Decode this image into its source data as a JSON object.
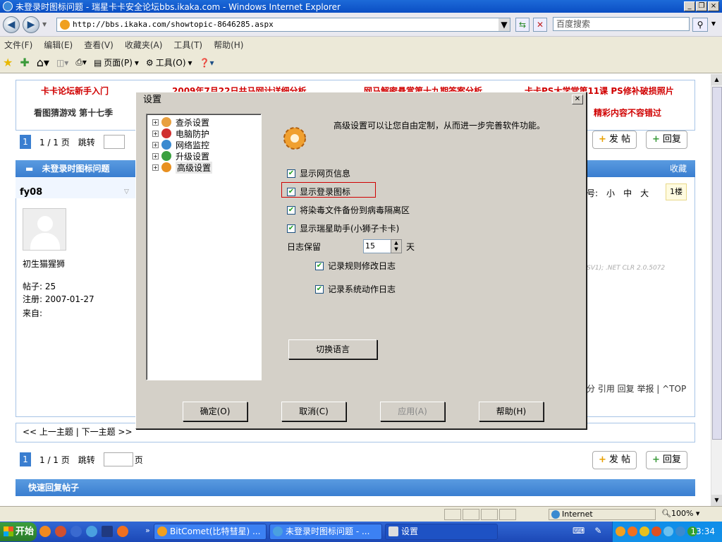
{
  "window": {
    "title": "未登录时图标问题 - 瑞星卡卡安全论坛bbs.ikaka.com - Windows Internet Explorer"
  },
  "browser": {
    "address": "http://bbs.ikaka.com/showtopic-8646285.aspx",
    "search_placeholder": "百度搜索",
    "menu": [
      "文件(F)",
      "编辑(E)",
      "查看(V)",
      "收藏夹(A)",
      "工具(T)",
      "帮助(H)"
    ],
    "toolbar": {
      "page_label": "页面(P)",
      "tools_label": "工具(O)"
    },
    "zone": "Internet",
    "zoom": "100%"
  },
  "forum": {
    "links_row1": [
      "卡卡论坛新手入门",
      "2009年7月22日共马网计详细分析",
      "网马解密悬赏第十九期答案分析",
      "卡卡PS大学堂第11课 PS修补破损照片"
    ],
    "links_row2": [
      "看图猜游戏 第十七季",
      "精彩内容不容错过"
    ],
    "pager": {
      "current": "1",
      "text": "1 / 1 页",
      "goto": "跳转",
      "page_suffix": "页"
    },
    "post_button": "发 帖",
    "reply_button": "回复",
    "topic_title": "未登录时图标问题",
    "favorite": "收藏",
    "user": {
      "name": "fy08",
      "rank": "初生猫猩狮",
      "posts": "帖子: 25",
      "registered_label": "注册:",
      "registered": "2007-01-27",
      "from": "来自:"
    },
    "font_sizes": {
      "label": "号:",
      "small": "小",
      "medium": "中",
      "large": "大",
      "floor": "1楼"
    },
    "ua_text": "SV1); .NET CLR 2.0.5072",
    "post_actions": "分 引用 回复 举报 | ^TOP",
    "nav_topics": "<< 上一主题 | 下一主题 >>",
    "quick_reply": "快速回复帖子"
  },
  "dialog": {
    "title": "设置",
    "tree": [
      "查杀设置",
      "电脑防护",
      "网络监控",
      "升级设置",
      "高级设置"
    ],
    "description": "高级设置可以让您自由定制，从而进一步完善软件功能。",
    "options": [
      {
        "label": "显示网页信息",
        "checked": true
      },
      {
        "label": "显示登录图标",
        "checked": true
      },
      {
        "label": "将染毒文件备份到病毒隔离区",
        "checked": true
      },
      {
        "label": "显示瑞星助手(小狮子卡卡)",
        "checked": true
      }
    ],
    "log_label": "日志保留",
    "log_value": "15",
    "log_unit": "天",
    "log_options": [
      {
        "label": "记录规则修改日志",
        "checked": true
      },
      {
        "label": "记录系统动作日志",
        "checked": true
      }
    ],
    "switch_lang": "切换语言",
    "buttons": {
      "ok": "确定(O)",
      "cancel": "取消(C)",
      "apply": "应用(A)",
      "help": "帮助(H)"
    }
  },
  "taskbar": {
    "start": "开始",
    "tasks": [
      "BitComet(比特彗星) ...",
      "未登录时图标问题 - ...",
      "设置"
    ],
    "clock": "13:34"
  },
  "colors": {
    "accent": "#3a7ed0",
    "link_red": "#d00000",
    "highlight_box": "#d00000"
  }
}
